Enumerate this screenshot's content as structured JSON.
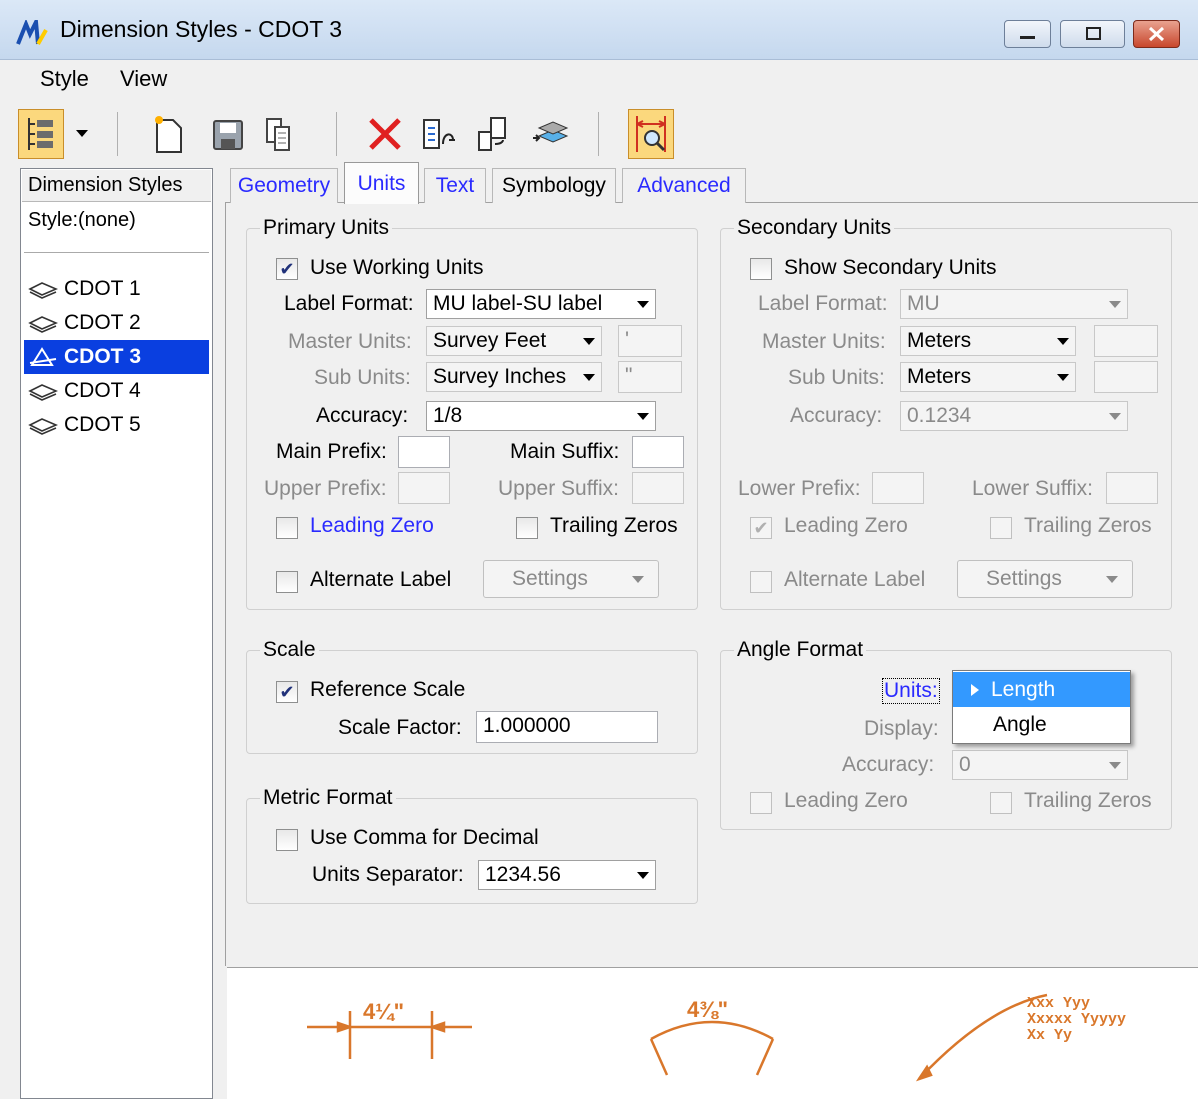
{
  "window": {
    "title": "Dimension Styles -  CDOT 3"
  },
  "menu": {
    "style": "Style",
    "view": "View"
  },
  "toolbar": {
    "buttons": [
      "hierarchy-dropdown",
      "new-style",
      "save-style",
      "copy-style",
      "delete-style",
      "import-style",
      "export-style",
      "upgrade-style",
      "preview-toggle"
    ]
  },
  "left_panel": {
    "header": "Dimension Styles",
    "style_label": "Style:(none)",
    "items": [
      "CDOT 1",
      "CDOT 2",
      "CDOT 3",
      "CDOT 4",
      "CDOT 5"
    ],
    "selected": "CDOT 3"
  },
  "tabs": [
    "Geometry",
    "Units",
    "Text",
    "Symbology",
    "Advanced"
  ],
  "active_tab": "Units",
  "primary": {
    "title": "Primary Units",
    "use_working_units": "Use Working Units",
    "label_format_lbl": "Label Format:",
    "label_format_val": "MU label-SU label",
    "master_lbl": "Master Units:",
    "master_val": "Survey Feet",
    "master_sym": "'",
    "sub_lbl": "Sub Units:",
    "sub_val": "Survey Inches",
    "sub_sym": "\"",
    "accuracy_lbl": "Accuracy:",
    "accuracy_val": "1/8",
    "main_prefix": "Main Prefix:",
    "main_suffix": "Main Suffix:",
    "upper_prefix": "Upper Prefix:",
    "upper_suffix": "Upper Suffix:",
    "leading_zero": "Leading Zero",
    "trailing_zeros": "Trailing Zeros",
    "alternate_label": "Alternate Label",
    "settings": "Settings"
  },
  "secondary": {
    "title": "Secondary Units",
    "show": "Show Secondary Units",
    "label_format_lbl": "Label Format:",
    "label_format_val": "MU",
    "master_lbl": "Master Units:",
    "master_val": "Meters",
    "sub_lbl": "Sub Units:",
    "sub_val": "Meters",
    "accuracy_lbl": "Accuracy:",
    "accuracy_val": "0.1234",
    "lower_prefix": "Lower Prefix:",
    "lower_suffix": "Lower Suffix:",
    "leading_zero": "Leading Zero",
    "trailing_zeros": "Trailing Zeros",
    "alternate_label": "Alternate Label",
    "settings": "Settings"
  },
  "scale": {
    "title": "Scale",
    "reference_scale": "Reference Scale",
    "factor_lbl": "Scale Factor:",
    "factor_val": "1.000000"
  },
  "metric": {
    "title": "Metric Format",
    "use_comma": "Use Comma for Decimal",
    "separator_lbl": "Units Separator:",
    "separator_val": "1234.56"
  },
  "angle": {
    "title": "Angle Format",
    "units_lbl": "Units:",
    "display_lbl": "Display:",
    "accuracy_lbl": "Accuracy:",
    "accuracy_val": "0",
    "leading_zero": "Leading Zero",
    "trailing_zeros": "Trailing Zeros",
    "popup_items": [
      "Length",
      "Angle"
    ]
  },
  "preview": {
    "linear": "4¼\"",
    "angular": "4⅜\"",
    "label": {
      "line1": "Xxx Yyy",
      "line2": "Xxxxx Yyyyy",
      "line3": "Xx Yy"
    }
  },
  "colors": {
    "accent": "#0a3fe0",
    "dim": "#d9772b",
    "tab_link": "#2a2aff",
    "popup_highlight": "#3399ff"
  }
}
